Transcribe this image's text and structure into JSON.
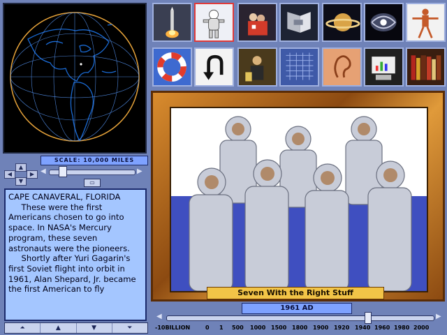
{
  "globe": {
    "scale_label": "SCALE: 10,000 MILES"
  },
  "text_panel": {
    "location": "CAPE CANAVERAL, FLORIDA",
    "paragraphs": [
      "These were the first Americans chosen to go into space. In NASA's Mercury program, these seven astronauts were the pioneers.",
      "Shortly after Yuri Gagarin's first Soviet flight into orbit in 1961, Alan Shepard, Jr. became the first American to fly"
    ]
  },
  "scroll_buttons": [
    "⏶",
    "▲",
    "▼",
    "⏷"
  ],
  "icons_row1": [
    "rocket-launch-icon",
    "astronaut-icon",
    "shuttle-crew-icon",
    "satellite-icon",
    "saturn-icon",
    "galaxy-icon",
    "human-body-icon"
  ],
  "icons_row2": [
    "life-preserver-icon",
    "u-turn-back-icon",
    "scientist-icon",
    "grid-panel-icon",
    "ear-icon",
    "chart-computer-icon",
    "library-books-icon"
  ],
  "selected_icon": "astronaut-icon",
  "picture": {
    "caption": "Seven With the Right Stuff"
  },
  "timeline": {
    "date": "1961 AD",
    "ticks": [
      "-10BILLION",
      "0",
      "1",
      "500",
      "1000",
      "1500",
      "1800",
      "1900",
      "1920",
      "1940",
      "1960",
      "1980",
      "2000"
    ],
    "position_fraction": 0.79
  }
}
